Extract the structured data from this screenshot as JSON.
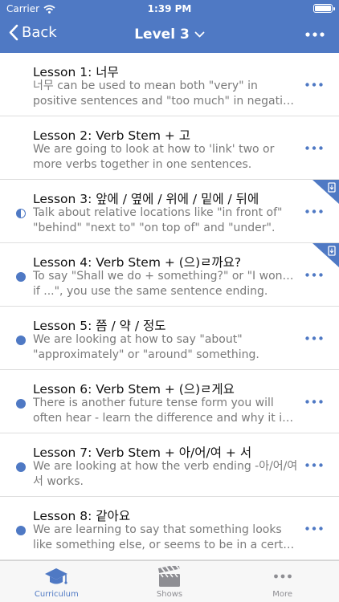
{
  "status_bar": {
    "carrier": "Carrier",
    "time": "1:39 PM"
  },
  "nav": {
    "back_label": "Back",
    "title": "Level 3"
  },
  "colors": {
    "accent": "#4f79c4",
    "header_bg": "#4f79c4",
    "subtitle": "#7a7a7a"
  },
  "lessons": [
    {
      "title": "Lesson 1: 너무",
      "desc1": "너무 can be used to mean both \"very\" in",
      "desc2": "positive sentences and \"too much\" in negativ...",
      "status": "none",
      "download": false
    },
    {
      "title": "Lesson 2: Verb Stem + 고",
      "desc1": "We are going to look at how to 'link' two or",
      "desc2": "more verbs together in one sentences.",
      "status": "none",
      "download": false
    },
    {
      "title": "Lesson 3: 앞에 / 옆에 / 위에 / 밑에 / 뒤에",
      "desc1": "Talk about relative locations like \"in front of\"",
      "desc2": "\"behind\" \"next to\" \"on top of\" and \"under\".",
      "status": "half",
      "download": true
    },
    {
      "title": "Lesson 4: Verb Stem + (으)ㄹ까요?",
      "desc1": "To say \"Shall we do + something?\" or \"I wonder",
      "desc2": "if ...\", you use the same sentence ending.",
      "status": "full",
      "download": true
    },
    {
      "title": "Lesson 5: 쯤 / 약 / 정도",
      "desc1": "We are looking at how to say \"about\"",
      "desc2": "\"approximately\" or \"around\" something.",
      "status": "full",
      "download": false
    },
    {
      "title": "Lesson 6: Verb Stem + (으)ㄹ게요",
      "desc1": "There is another future tense form you will",
      "desc2": "often hear - learn the difference and why it is...",
      "status": "full",
      "download": false
    },
    {
      "title": "Lesson 7: Verb Stem + 아/어/여 + 서",
      "desc1": "We are looking at how the verb ending -아/어/여",
      "desc2": "서 works.",
      "status": "full",
      "download": false
    },
    {
      "title": "Lesson 8: 같아요",
      "desc1": "We are learning to say that something looks",
      "desc2": "like something else, or seems to be in a certa...",
      "status": "full",
      "download": false
    }
  ],
  "tabs": [
    {
      "label": "Curriculum",
      "icon": "graduation-cap-icon",
      "active": true
    },
    {
      "label": "Shows",
      "icon": "clapperboard-icon",
      "active": false
    },
    {
      "label": "More",
      "icon": "more-dots-icon",
      "active": false
    }
  ]
}
